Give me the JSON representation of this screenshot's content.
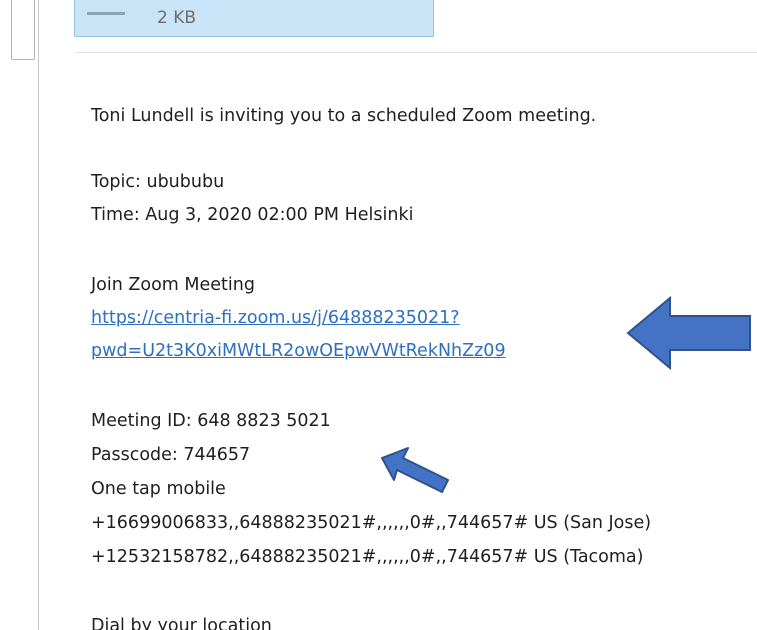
{
  "attachment": {
    "size": "2 KB"
  },
  "message": {
    "invite_line": "Toni Lundell is inviting you to a scheduled Zoom meeting.",
    "topic": "Topic: ubububu",
    "time": "Time: Aug 3, 2020 02:00 PM Helsinki",
    "join_heading": "Join Zoom Meeting",
    "join_link_line1": "https://centria-fi.zoom.us/j/64888235021?",
    "join_link_line2": "pwd=U2t3K0xiMWtLR2owOEpwVWtRekNhZz09",
    "meeting_id": "Meeting ID: 648 8823 5021",
    "passcode": "Passcode: 744657",
    "one_tap_heading": "One tap mobile",
    "one_tap_1": "+16699006833,,64888235021#,,,,,,0#,,744657# US (San Jose)",
    "one_tap_2": "+12532158782,,64888235021#,,,,,,0#,,744657# US (Tacoma)",
    "dial_heading": "Dial by your location"
  },
  "colors": {
    "link": "#2f6fbf",
    "arrow_fill": "#4472c4",
    "arrow_stroke": "#2f528f",
    "attachment_bg": "#c9e4f6"
  }
}
